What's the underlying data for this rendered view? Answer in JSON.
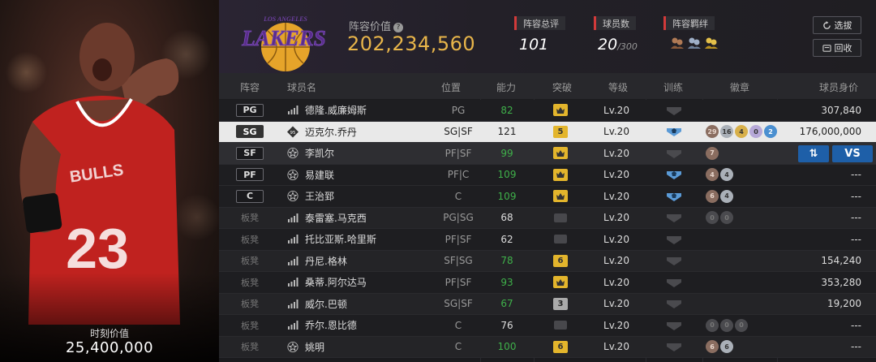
{
  "card": {
    "moment_label": "时刻价值",
    "moment_value": "25,400,000"
  },
  "header": {
    "logo_top": "LOS ANGELES",
    "logo_main": "LAKERS",
    "lineup_value_label": "阵容价值",
    "lineup_value": "202,234,560",
    "stats": [
      {
        "label": "阵容总评",
        "value": "101"
      },
      {
        "label": "球员数",
        "value": "20",
        "sub": "/300"
      },
      {
        "label": "阵容羁绊"
      }
    ],
    "buttons": [
      {
        "label": "选拔",
        "icon": "refresh-icon"
      },
      {
        "label": "回收",
        "icon": "recycle-icon"
      }
    ]
  },
  "columns": [
    "阵容",
    "球员名",
    "位置",
    "能力",
    "突破",
    "等级",
    "训练",
    "徽章",
    "球员身价"
  ],
  "rows": [
    {
      "slot": "PG",
      "bench": false,
      "tier": "bars",
      "name": "德隆.威廉姆斯",
      "pos": "PG",
      "ability": "82",
      "ability_color": "green",
      "breakthrough": "crown",
      "brk_color": "gold",
      "level": "Lv.20",
      "train": "none",
      "badges": [],
      "worth": "307,840",
      "style": "dark"
    },
    {
      "slot": "SG",
      "bench": false,
      "tier": "diamond",
      "tier_label": "95",
      "name": "迈克尔.乔丹",
      "pos": "SG|SF",
      "ability": "121",
      "ability_color": "white",
      "breakthrough": "5",
      "brk_color": "gold",
      "level": "Lv.20",
      "train": "blue",
      "badges": [
        {
          "v": "29",
          "c": "brz"
        },
        {
          "v": "16",
          "c": "sil"
        },
        {
          "v": "4",
          "c": "gld"
        },
        {
          "v": "0",
          "c": "pur"
        },
        {
          "v": "2",
          "c": "blu"
        }
      ],
      "worth": "176,000,000",
      "style": "selected"
    },
    {
      "slot": "SF",
      "bench": false,
      "tier": "star",
      "name": "李凯尔",
      "pos": "PF|SF",
      "ability": "99",
      "ability_color": "green",
      "breakthrough": "crown",
      "brk_color": "gold",
      "level": "Lv.20",
      "train": "none",
      "badges": [
        {
          "v": "7",
          "c": "brz"
        }
      ],
      "worth": "",
      "style": "hover",
      "actions": [
        "⇅",
        "VS"
      ]
    },
    {
      "slot": "PF",
      "bench": false,
      "tier": "star",
      "name": "易建联",
      "pos": "PF|C",
      "ability": "109",
      "ability_color": "green",
      "breakthrough": "crown",
      "brk_color": "gold",
      "level": "Lv.20",
      "train": "blue",
      "badges": [
        {
          "v": "4",
          "c": "brz"
        },
        {
          "v": "4",
          "c": "sil"
        }
      ],
      "worth": "---",
      "style": "dark"
    },
    {
      "slot": "C",
      "bench": false,
      "tier": "star",
      "name": "王治郅",
      "pos": "C",
      "ability": "109",
      "ability_color": "green",
      "breakthrough": "crown",
      "brk_color": "gold",
      "level": "Lv.20",
      "train": "blue",
      "badges": [
        {
          "v": "6",
          "c": "brz"
        },
        {
          "v": "4",
          "c": "sil"
        }
      ],
      "worth": "---",
      "style": "dark"
    },
    {
      "slot": "板凳",
      "bench": true,
      "tier": "bars",
      "name": "泰雷塞.马克西",
      "pos": "PG|SG",
      "ability": "68",
      "ability_color": "white",
      "breakthrough": "none",
      "brk_color": "none",
      "level": "Lv.20",
      "train": "none",
      "badges": [
        {
          "v": "0",
          "c": "drk"
        },
        {
          "v": "0",
          "c": "drk"
        }
      ],
      "worth": "---",
      "style": "light"
    },
    {
      "slot": "板凳",
      "bench": true,
      "tier": "bars",
      "name": "托比亚斯.哈里斯",
      "pos": "PF|SF",
      "ability": "62",
      "ability_color": "white",
      "breakthrough": "none",
      "brk_color": "none",
      "level": "Lv.20",
      "train": "none",
      "badges": [],
      "worth": "---",
      "style": "dark"
    },
    {
      "slot": "板凳",
      "bench": true,
      "tier": "bars",
      "name": "丹尼.格林",
      "pos": "SF|SG",
      "ability": "78",
      "ability_color": "green",
      "breakthrough": "6",
      "brk_color": "gold",
      "level": "Lv.20",
      "train": "none",
      "badges": [],
      "worth": "154,240",
      "style": "light"
    },
    {
      "slot": "板凳",
      "bench": true,
      "tier": "bars",
      "name": "桑蒂.阿尔达马",
      "pos": "PF|SF",
      "ability": "93",
      "ability_color": "green",
      "breakthrough": "crown",
      "brk_color": "gold",
      "level": "Lv.20",
      "train": "none",
      "badges": [],
      "worth": "353,280",
      "style": "dark"
    },
    {
      "slot": "板凳",
      "bench": true,
      "tier": "bars",
      "name": "威尔.巴顿",
      "pos": "SG|SF",
      "ability": "67",
      "ability_color": "green",
      "breakthrough": "3",
      "brk_color": "gray",
      "level": "Lv.20",
      "train": "none",
      "badges": [],
      "worth": "19,200",
      "style": "light"
    },
    {
      "slot": "板凳",
      "bench": true,
      "tier": "bars",
      "name": "乔尔.恩比德",
      "pos": "C",
      "ability": "76",
      "ability_color": "white",
      "breakthrough": "none",
      "brk_color": "none",
      "level": "Lv.20",
      "train": "none",
      "badges": [
        {
          "v": "0",
          "c": "drk"
        },
        {
          "v": "0",
          "c": "drk"
        },
        {
          "v": "0",
          "c": "drk"
        }
      ],
      "worth": "---",
      "style": "dark"
    },
    {
      "slot": "板凳",
      "bench": true,
      "tier": "star",
      "name": "姚明",
      "pos": "C",
      "ability": "100",
      "ability_color": "green",
      "breakthrough": "6",
      "brk_color": "gold",
      "level": "Lv.20",
      "train": "none",
      "badges": [
        {
          "v": "6",
          "c": "brz"
        },
        {
          "v": "6",
          "c": "sil"
        }
      ],
      "worth": "---",
      "style": "light"
    }
  ]
}
